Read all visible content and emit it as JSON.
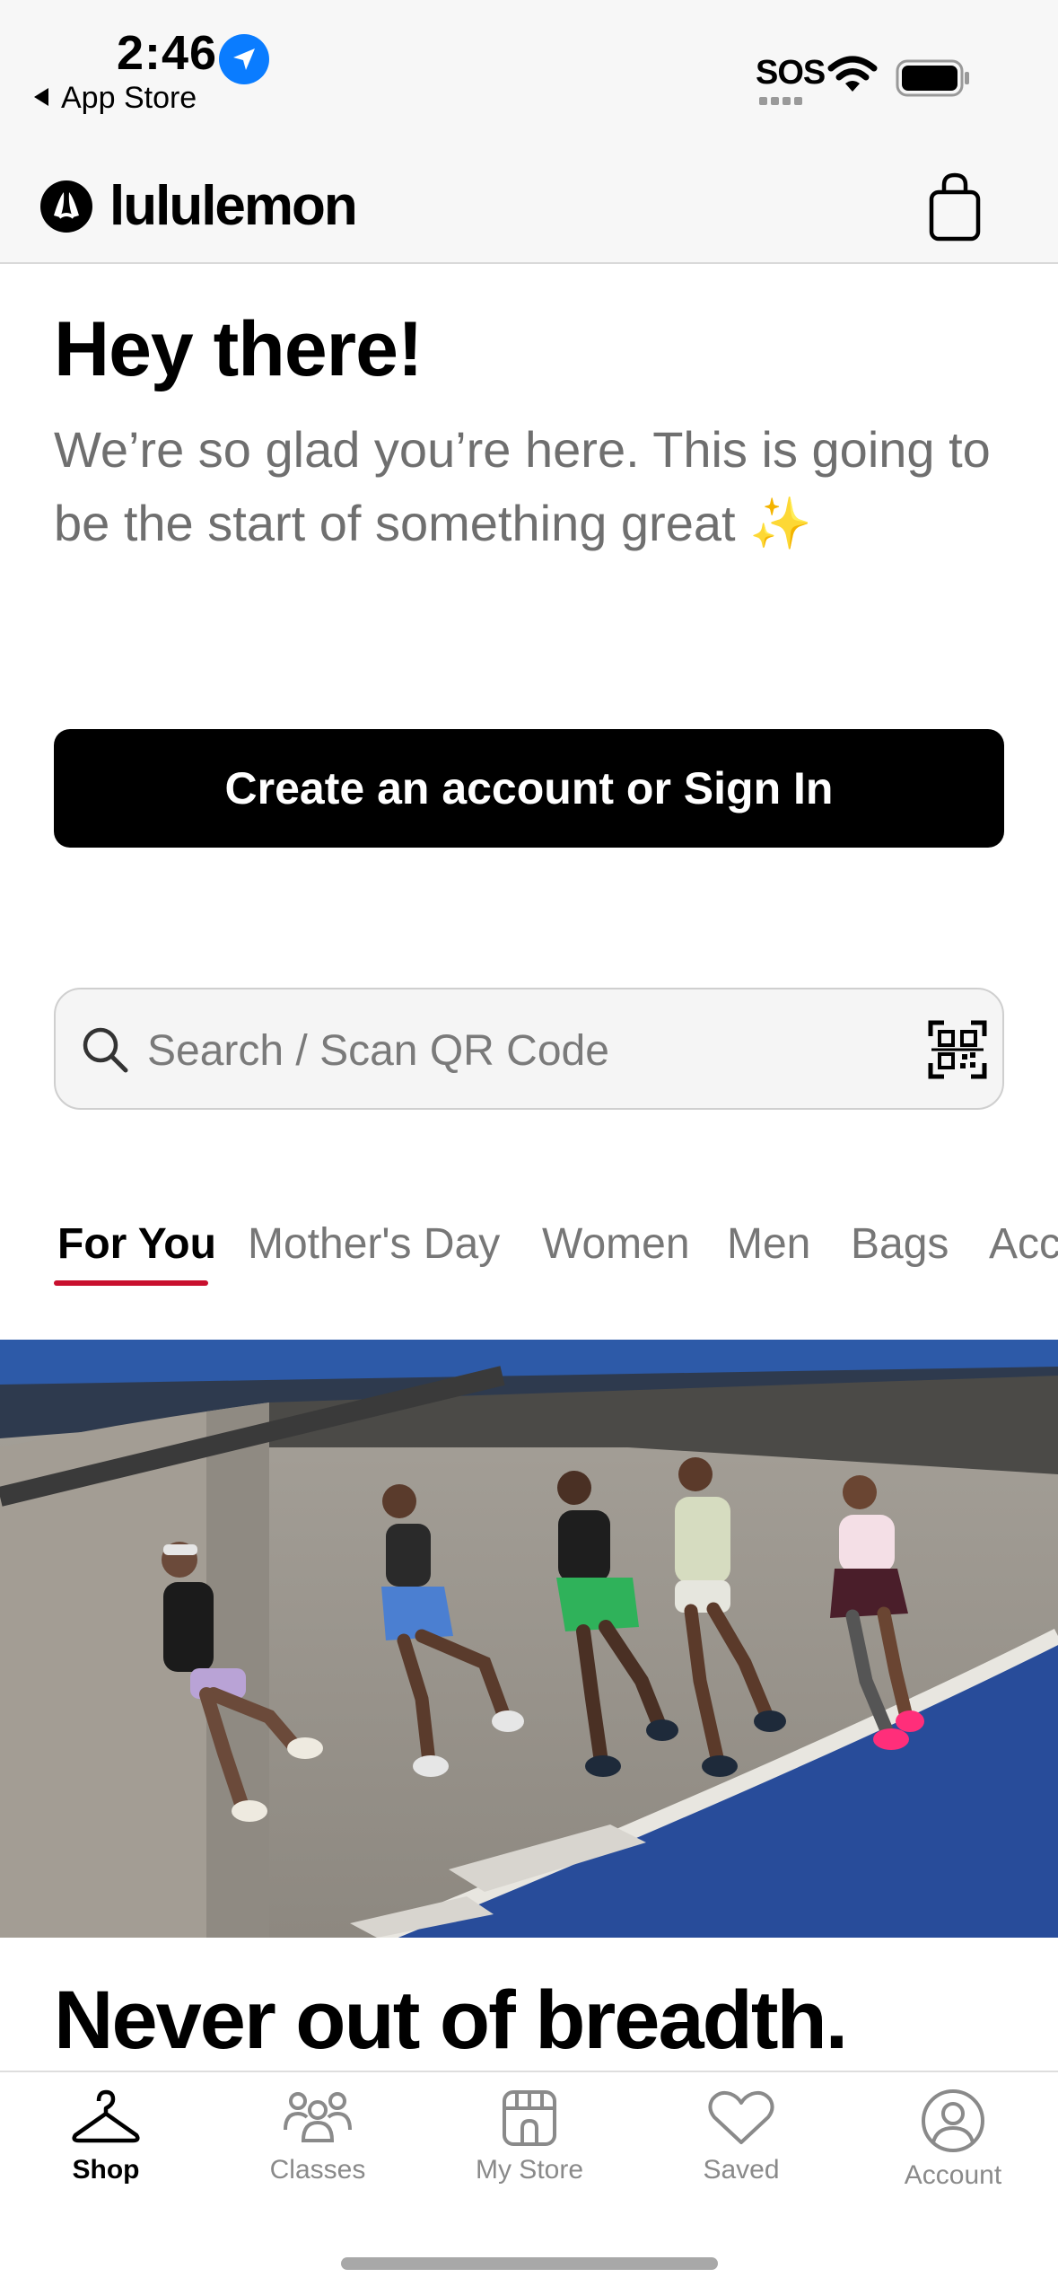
{
  "status_bar": {
    "time": "2:46",
    "back_label": "App Store",
    "sos": "SOS"
  },
  "header": {
    "brand": "lululemon"
  },
  "welcome": {
    "title": "Hey there!",
    "subtitle": "We’re so glad you’re here. This is going to be the start of something great",
    "sparkle": "✨",
    "cta_label": "Create an account or Sign In"
  },
  "search": {
    "placeholder": "Search / Scan QR Code"
  },
  "category_tabs": [
    "For You",
    "Mother's Day",
    "Women",
    "Men",
    "Bags",
    "Acc"
  ],
  "hero": {
    "title": "Never out of breadth."
  },
  "tab_bar": {
    "items": [
      "Shop",
      "Classes",
      "My Store",
      "Saved",
      "Account"
    ],
    "active": "Shop"
  },
  "colors": {
    "accent_underline": "#c8102e",
    "cta_background": "#000000",
    "location_badge": "#0a7cff"
  }
}
